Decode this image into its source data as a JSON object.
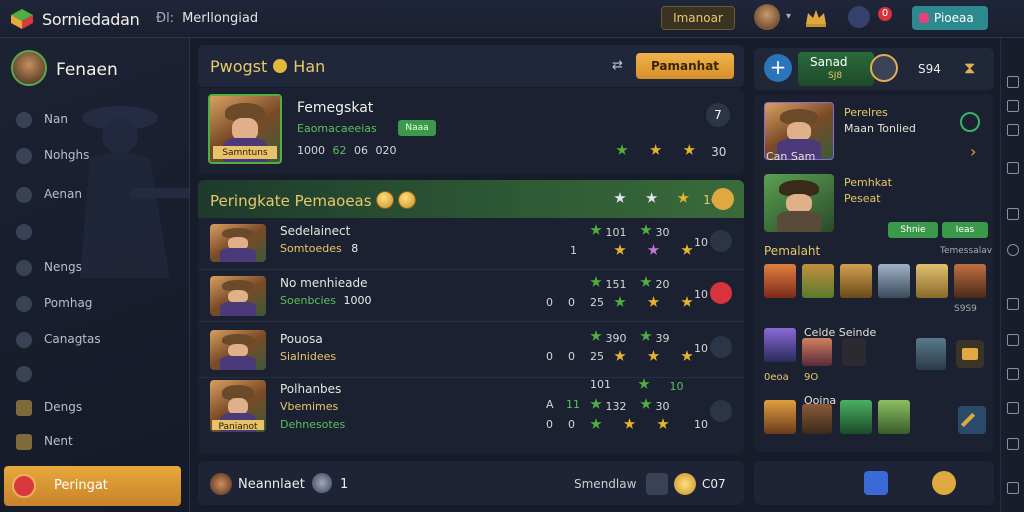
{
  "topbar": {
    "app_title": "Sorniedadan",
    "crumb_prefix": "Ðl:",
    "crumb_page": "Merllongiad",
    "gold_button": "Imanoar",
    "alert_count": "0",
    "teal_button": "Pioeaa"
  },
  "sidebar": {
    "profile_name": "Fenaen",
    "items": [
      {
        "label": "Nan",
        "icon": "home-icon"
      },
      {
        "label": "Nohghs",
        "icon": "person-icon"
      },
      {
        "label": "Aenan",
        "icon": "house-icon"
      },
      {
        "label": "",
        "icon": "globe-icon"
      },
      {
        "label": "Nengs",
        "icon": "swords-icon"
      },
      {
        "label": "Pomhag",
        "icon": "shield-icon"
      },
      {
        "label": "Canagtas",
        "icon": "compass-icon"
      },
      {
        "label": "",
        "icon": "heart-icon"
      },
      {
        "label": "Dengs",
        "icon": "chest-icon"
      },
      {
        "label": "Nent",
        "icon": "book-icon"
      }
    ],
    "active": "Peringat"
  },
  "main": {
    "title_left": "Pwogst",
    "title_right": "Han",
    "header_button": "Pamanhat",
    "hero": {
      "name": "Femegskat",
      "sub": "Eaomacaeeias",
      "badge": "Naaa",
      "portrait_tag": "Samntuns",
      "stats": [
        "1000",
        "62",
        "06",
        "020"
      ],
      "rank_num": "7",
      "right_val": "30"
    },
    "rank": {
      "title": "Peringkate Pemaoeas",
      "right_val": "16",
      "rows": [
        {
          "name": "Sedelainect",
          "sub": "Somtoedes",
          "sub_color": "y",
          "extra": "8",
          "vals": [
            "1",
            "101",
            "30",
            "10"
          ],
          "tag": ""
        },
        {
          "name": "No menhieade",
          "sub": "Soenbcies",
          "sub_color": "g",
          "extra": "1000",
          "vals": [
            "0",
            "0",
            "25",
            "151",
            "20",
            "10"
          ],
          "tag": ""
        },
        {
          "name": "Pouosa",
          "sub": "Sialnidees",
          "sub_color": "y",
          "extra": "",
          "vals": [
            "0",
            "0",
            "25",
            "390",
            "39",
            "10"
          ],
          "tag": ""
        },
        {
          "name": "Polhanbes",
          "sub": "Vbemimes",
          "sub_color": "y",
          "extra": "",
          "vals": [
            "A",
            "11",
            "101",
            "132",
            "30",
            "10"
          ],
          "tag": "Panianot"
        },
        {
          "name": "",
          "sub": "Dehnesotes",
          "sub_color": "g",
          "extra": "",
          "vals": [
            "0",
            "0",
            "10"
          ],
          "tag": ""
        }
      ]
    },
    "bottom": {
      "left_label": "Neannlaet",
      "left_count": "1",
      "right_label": "Smendlaw",
      "right_val": "C07"
    }
  },
  "right": {
    "top": {
      "green_l1": "Sanad",
      "green_l2": "SJ8",
      "value": "S94"
    },
    "card1": {
      "l1": "Perelres",
      "l2": "Maan Tonlied",
      "caption": "Can Sam"
    },
    "card2": {
      "l1": "Pemhkat",
      "l2": "Peseat",
      "btn1": "Shnie",
      "btn2": "Ieas",
      "caption": "Temessalav"
    },
    "section_a": "Pemalaht",
    "section_a_val": "S9S9",
    "section_b": "Celde Seinde",
    "section_b_caption": "0eoa",
    "section_b_val": "9O",
    "section_c": "Ooina"
  },
  "colors": {
    "accent_gold": "#e9c86a",
    "accent_green": "#58c25a",
    "active_nav": "#e8a83c"
  }
}
